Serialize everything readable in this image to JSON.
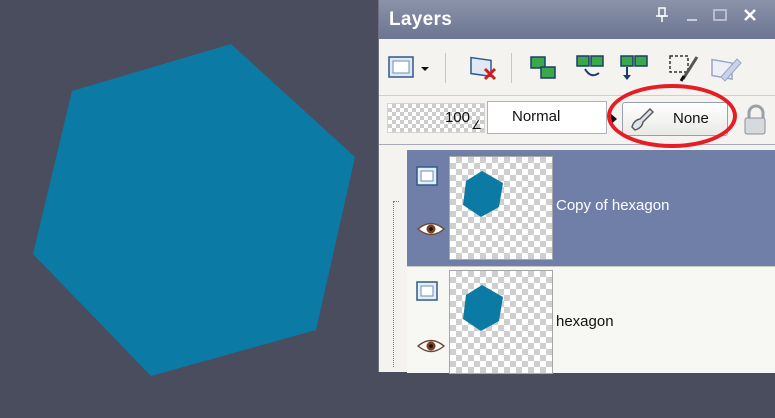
{
  "canvas": {
    "background": "#4a4d5e",
    "shape_color": "#0b7aa4",
    "shape_name": "hexagon"
  },
  "panel": {
    "title": "Layers",
    "title_buttons": [
      "pin-icon",
      "minimize-icon",
      "maximize-icon",
      "close-icon"
    ],
    "toolbar_icons": [
      "new-layer-icon",
      "delete-layer-icon",
      "duplicate-layer-icon",
      "merge-down-icon",
      "merge-all-icon",
      "promote-selection-icon",
      "edit-selection-icon",
      "properties-icon"
    ]
  },
  "options": {
    "opacity": "100",
    "blend_mode": "Normal",
    "mask": "None",
    "highlight_color": "#e51d25"
  },
  "layers": [
    {
      "name": "Copy of hexagon",
      "selected": true
    },
    {
      "name": "hexagon",
      "selected": false
    }
  ],
  "colors": {
    "selection": "#6f7fa8",
    "panel_bg": "#f4f3ef",
    "titlebar": "#7c84a0"
  }
}
